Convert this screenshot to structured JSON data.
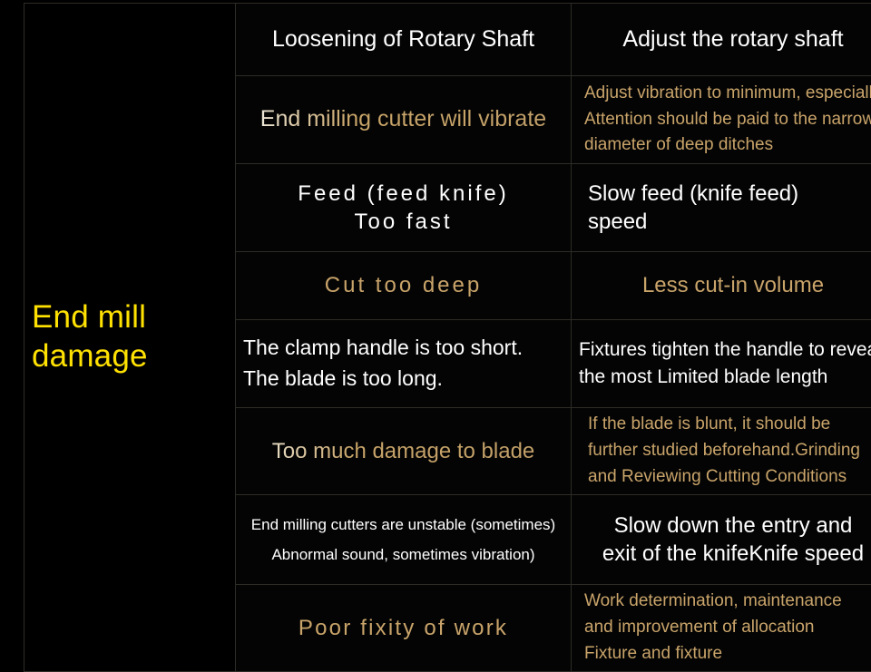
{
  "slide": {
    "background_color": "#000000",
    "accent_yellow": "#ffe100",
    "accent_gold": "#c9a46a",
    "text_white": "#ffffff",
    "border_color": "#2e2c26"
  },
  "table": {
    "cause_heading": "End mill\ndamage",
    "rows": [
      {
        "symptom": "Loosening of Rotary Shaft",
        "remedy": "Adjust the rotary shaft"
      },
      {
        "symptom": "End milling cutter will vibrate",
        "remedy": "Adjust vibration to minimum, especially\nAttention should be paid to the narrow\ndiameter of deep ditches"
      },
      {
        "symptom": "Feed (feed knife)\nToo fast",
        "remedy": "Slow feed (knife feed)\nspeed"
      },
      {
        "symptom": "Cut too deep",
        "remedy": "Less cut-in volume"
      },
      {
        "symptom": "The clamp handle is too short.\nThe blade is too long.",
        "remedy": "Fixtures tighten the handle to reveal\nthe most Limited blade length"
      },
      {
        "symptom": "Too much damage to blade",
        "remedy": "If the blade is blunt, it should be\nfurther studied beforehand.Grinding\nand Reviewing Cutting Conditions"
      },
      {
        "symptom": "End milling cutters are unstable (sometimes)\nAbnormal sound, sometimes vibration)",
        "remedy": "Slow down the entry and\nexit of the knifeKnife speed"
      },
      {
        "symptom": "Poor fixity of work",
        "remedy": "Work determination, maintenance\nand improvement of allocation\nFixture and fixture"
      }
    ]
  }
}
